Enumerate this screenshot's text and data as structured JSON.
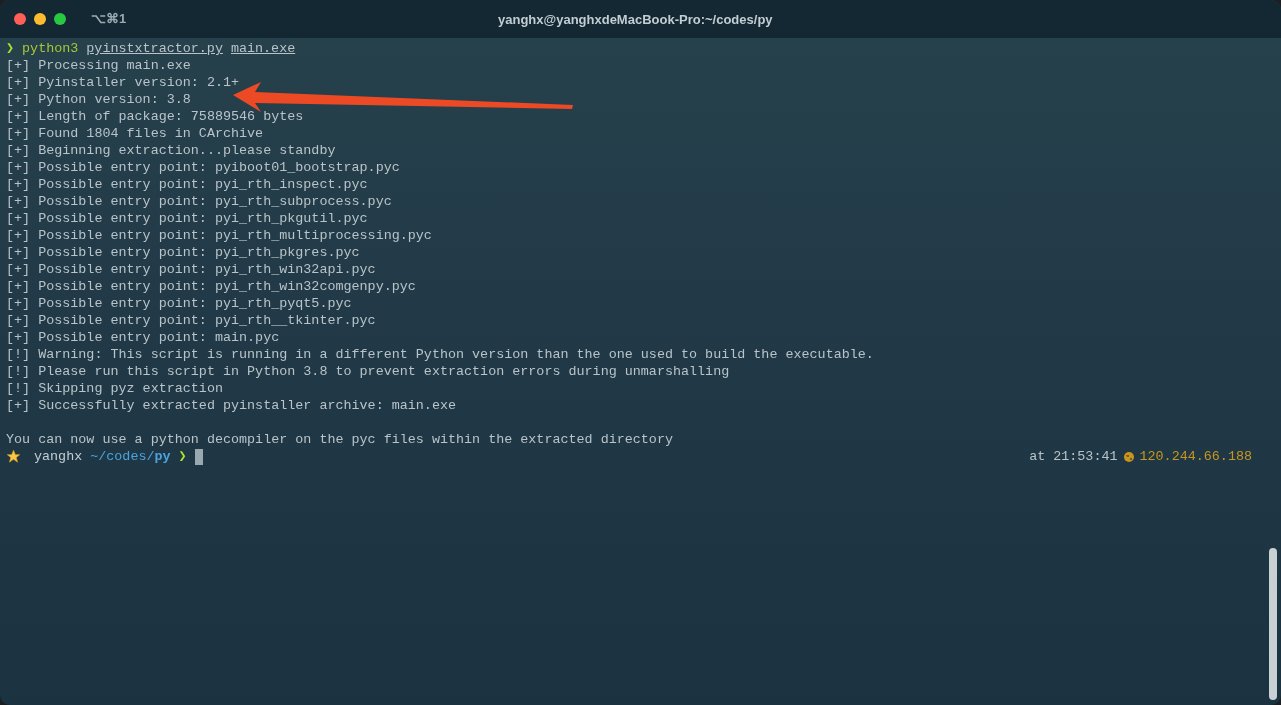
{
  "window": {
    "title": "yanghx@yanghxdeMacBook-Pro:~/codes/py",
    "shortcut": "⌥⌘1"
  },
  "command": {
    "prompt": "❯",
    "program": "python3",
    "args": [
      "pyinstxtractor.py",
      "main.exe"
    ]
  },
  "output": [
    "[+] Processing main.exe",
    "[+] Pyinstaller version: 2.1+",
    "[+] Python version: 3.8",
    "[+] Length of package: 75889546 bytes",
    "[+] Found 1804 files in CArchive",
    "[+] Beginning extraction...please standby",
    "[+] Possible entry point: pyiboot01_bootstrap.pyc",
    "[+] Possible entry point: pyi_rth_inspect.pyc",
    "[+] Possible entry point: pyi_rth_subprocess.pyc",
    "[+] Possible entry point: pyi_rth_pkgutil.pyc",
    "[+] Possible entry point: pyi_rth_multiprocessing.pyc",
    "[+] Possible entry point: pyi_rth_pkgres.pyc",
    "[+] Possible entry point: pyi_rth_win32api.pyc",
    "[+] Possible entry point: pyi_rth_win32comgenpy.pyc",
    "[+] Possible entry point: pyi_rth_pyqt5.pyc",
    "[+] Possible entry point: pyi_rth__tkinter.pyc",
    "[+] Possible entry point: main.pyc",
    "[!] Warning: This script is running in a different Python version than the one used to build the executable.",
    "[!] Please run this script in Python 3.8 to prevent extraction errors during unmarshalling",
    "[!] Skipping pyz extraction",
    "[+] Successfully extracted pyinstaller archive: main.exe"
  ],
  "message": "You can now use a python decompiler on the pyc files within the extracted directory",
  "prompt": {
    "user": "yanghx",
    "path": "~/codes/",
    "dir": "py",
    "symbol": "❯",
    "at": "at",
    "time": "21:53:41",
    "ip": "120.244.66.188"
  }
}
